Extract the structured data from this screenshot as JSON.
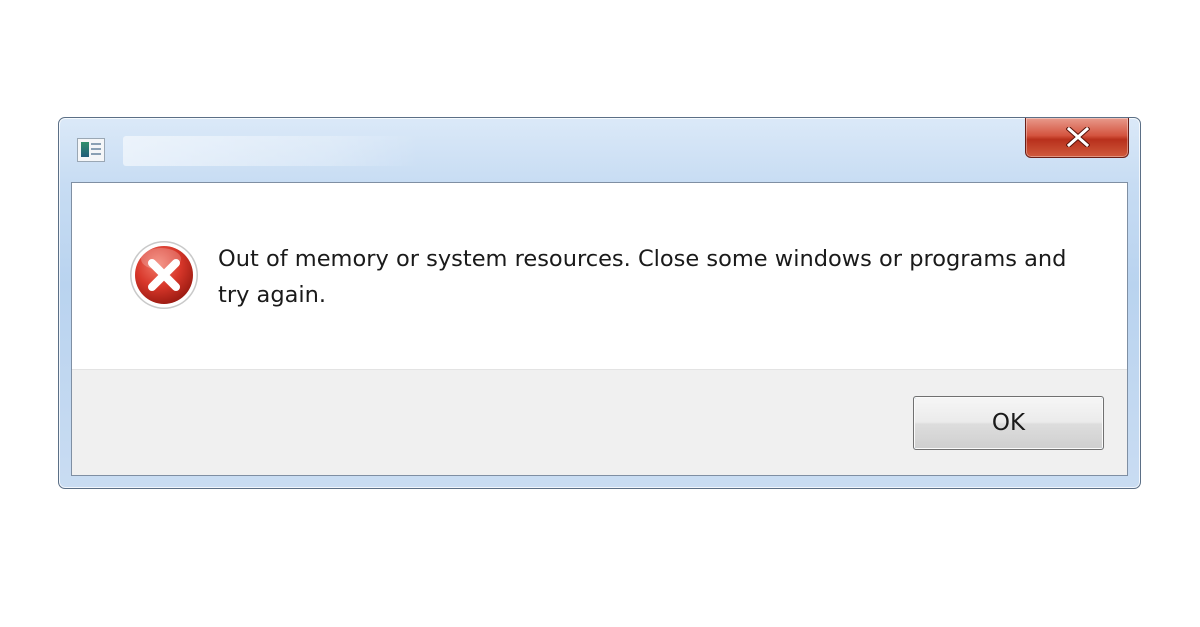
{
  "window": {
    "title": "",
    "app_icon": "application-icon",
    "close_icon": "close-icon"
  },
  "dialog": {
    "icon": "error-icon",
    "message": "Out of memory or system resources. Close some windows or programs and try again.",
    "ok_label": "OK"
  },
  "colors": {
    "error_red": "#d8372a",
    "close_red": "#c8412b",
    "frame_blue": "#c3d9f1",
    "button_area": "#f0f0f0"
  }
}
